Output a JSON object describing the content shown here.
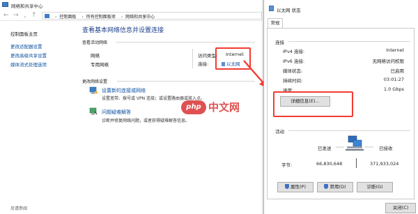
{
  "main_window": {
    "title": "网络和共享中心",
    "address": {
      "crumbs": [
        "控制面板",
        "所有控制面板项",
        "网络和共享中心"
      ]
    },
    "left_pane": {
      "home": "控制面板主页",
      "links": [
        "更改适配器设置",
        "更改高级共享设置",
        "媒体流式处理选项"
      ],
      "see_also": "另请参阅"
    },
    "content": {
      "title": "查看基本网络信息并设置连接",
      "active_networks_label": "查看活动网络",
      "network_name": "网络",
      "network_type": "专用网络",
      "access_type_label": "访问类型:",
      "access_type_value": "Internet",
      "connection_label": "连接:",
      "connection_value": "以太网",
      "change_settings_label": "更改网络设置",
      "tasks": [
        {
          "link": "设置新的连接或网络",
          "desc": "设置宽带、拨号或 VPN 连接；或设置路由器或接入点。"
        },
        {
          "link": "问题疑难解答",
          "desc": "诊断并修复网络问题，或者获得疑难解答信息。"
        }
      ]
    }
  },
  "watermark": {
    "php": "php",
    "cn": "中文网"
  },
  "dialog": {
    "title": "以太网 状态",
    "tab": "常规",
    "connection_group": "连接",
    "rows": [
      {
        "label": "IPv4 连接:",
        "value": "Internet"
      },
      {
        "label": "IPv6 连接:",
        "value": "无网络访问权限"
      },
      {
        "label": "媒体状态:",
        "value": "已启用"
      },
      {
        "label": "持续时间:",
        "value": "03:01:27"
      },
      {
        "label": "速度:",
        "value": "1.0 Gbps"
      }
    ],
    "details_button": "详细信息(E)...",
    "activity_group": "活动",
    "sent_label": "已发送",
    "received_label": "已接收",
    "bytes_label": "字节:",
    "bytes_sent": "66,830,648",
    "bytes_received": "371,933,024",
    "properties_button": "属性(P)",
    "disable_button": "禁用(D)",
    "diagnose_button": "诊断(G)",
    "close_button": "关闭(C)"
  },
  "colors": {
    "highlight": "#f23b32",
    "link": "#0a4f9e",
    "title": "#1e3f8c"
  }
}
